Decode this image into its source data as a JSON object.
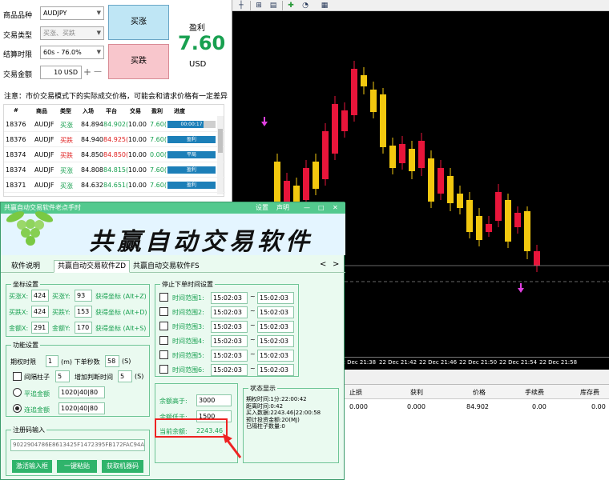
{
  "trade_panel": {
    "product_label": "商品品种",
    "product_value": "AUDJPY",
    "trade_type_label": "交易类型",
    "trade_type_value": "买涨、买跌",
    "settle_label": "结算时限",
    "settle_value": "60s - 76.0%",
    "amount_label": "交易金额",
    "amount_value": "10 USD",
    "plus_label": "+",
    "minus_label": "—",
    "buy_label": "买涨",
    "sell_label": "买跌",
    "profit_label": "盈利",
    "profit_value": "7.60",
    "currency": "USD",
    "note": "注意：市价交易模式下的实际成交价格，可能会和请求价格有一定差异",
    "columns": [
      "#",
      "商品",
      "类型",
      "入场",
      "平台",
      "交易",
      "盈利",
      "进度"
    ],
    "orders": [
      {
        "id": "18376",
        "symbol": "AUDJF",
        "type": "买涨",
        "entry": "84.894",
        "platform": "84.902(",
        "trade": "10.00",
        "profit": "7.60(76",
        "progress": "00:00:17",
        "fill": 0.75,
        "tcolor": "#18a050"
      },
      {
        "id": "18376",
        "symbol": "AUDJF",
        "type": "买跌",
        "entry": "84.940",
        "platform": "84.925(",
        "trade": "10.00",
        "profit": "7.60(76",
        "progress": "盈利",
        "fill": 1.0,
        "tcolor": "#e02020"
      },
      {
        "id": "18374",
        "symbol": "AUDJF",
        "type": "买跌",
        "entry": "84.850",
        "platform": "84.850(",
        "trade": "10.00",
        "profit": "0.00(76",
        "progress": "平局",
        "fill": 1.0,
        "tcolor": "#e02020"
      },
      {
        "id": "18374",
        "symbol": "AUDJF",
        "type": "买涨",
        "entry": "84.808",
        "platform": "84.815(",
        "trade": "10.00",
        "profit": "7.60(76",
        "progress": "盈利",
        "fill": 1.0,
        "tcolor": "#18a050"
      },
      {
        "id": "18371",
        "symbol": "AUDJF",
        "type": "买涨",
        "entry": "84.632",
        "platform": "84.651(",
        "trade": "10.00",
        "profit": "7.60(76",
        "progress": "盈利",
        "fill": 1.0,
        "tcolor": "#18a050"
      }
    ]
  },
  "software": {
    "window_title": "共赢自动交易软件老点手时",
    "menu_settings": "设置",
    "menu_about": "声明",
    "win_min": "—",
    "win_max": "□",
    "win_close": "✕",
    "banner_title": "共赢自动交易软件",
    "tabs": [
      "软件说明",
      "共赢自动交易软件ZD",
      "共赢自动交易软件FS"
    ],
    "tab_prev": "<",
    "tab_next": ">",
    "coords_title": "坐标设置",
    "buy_x_label": "买涨X:",
    "buy_x": "424",
    "buy_y_label": "买涨Y:",
    "buy_y": "93",
    "buy_get": "获得坐标 (Alt+Z)",
    "sell_x_label": "买跌X:",
    "sell_x": "424",
    "sell_y_label": "买跌Y:",
    "sell_y": "153",
    "sell_get": "获得坐标 (Alt+D)",
    "amt_x_label": "金额X:",
    "amt_x": "291",
    "amt_y_label": "金额Y:",
    "amt_y": "170",
    "amt_get": "获得坐标 (Alt+S)",
    "func_title": "功能设置",
    "period_label": "期权时限",
    "period_value": "1",
    "period_unit": "(m) 下单秒数",
    "seconds_value": "58",
    "seconds_unit": "(S)",
    "interval_label": "间隔柱子",
    "interval_value": "5",
    "delay_label": "增加判断时间",
    "delay_value": "5",
    "delay_unit": "(S)",
    "flat_label": "平追金额",
    "flat_value": "1020|40|80",
    "chain_label": "连追金额",
    "chain_value": "1020|40|80",
    "stop_title": "停止下单时间设置",
    "time_ranges": [
      {
        "label": "时间范围1:",
        "from": "15:02:03",
        "to": "15:02:03"
      },
      {
        "label": "时间范围2:",
        "from": "15:02:03",
        "to": "15:02:03"
      },
      {
        "label": "时间范围3:",
        "from": "15:02:03",
        "to": "15:02:03"
      },
      {
        "label": "时间范围4:",
        "from": "15:02:03",
        "to": "15:02:03"
      },
      {
        "label": "时间范围5:",
        "from": "15:02:03",
        "to": "15:02:03"
      },
      {
        "label": "时间范围6:",
        "from": "15:02:03",
        "to": "15:02:03"
      }
    ],
    "range_sep": "~",
    "balance_high_label": "余额高于:",
    "balance_high": "3000",
    "balance_low_label": "余额低于:",
    "balance_low": "1500",
    "current_balance_label": "当前余额:",
    "current_balance": "2243.46",
    "status_title": "状态显示",
    "status_lines": [
      "期权时间:1分:22:00:42",
      "距离时间:0:42",
      "买入数据:2243.46|22:00:58",
      "预计投资金额:20(MJ)",
      "已隔柱子数量:0"
    ],
    "reg_title": "注册码输入",
    "reg_code": "9022904786E8613425F1472395FB172FAC94A",
    "btn_activate": "激活输入框",
    "btn_paste": "一键粘贴",
    "btn_machine": "获取机器码"
  },
  "chart": {
    "time_labels": [
      "22 Dec 21:38",
      "22 Dec 21:42",
      "22 Dec 21:46",
      "22 Dec 21:50",
      "22 Dec 21:54",
      "22 Dec 21:58"
    ]
  },
  "terminal": {
    "columns": [
      "止损",
      "获利",
      "价格",
      "手续费",
      "库存费"
    ],
    "values": [
      "0.000",
      "0.000",
      "84.902",
      "0.00",
      "0.00"
    ]
  },
  "colors": {
    "bull": "#f2c80f",
    "bear": "#e8153a",
    "marker": "#e040e0",
    "accent": "#53c98e"
  }
}
